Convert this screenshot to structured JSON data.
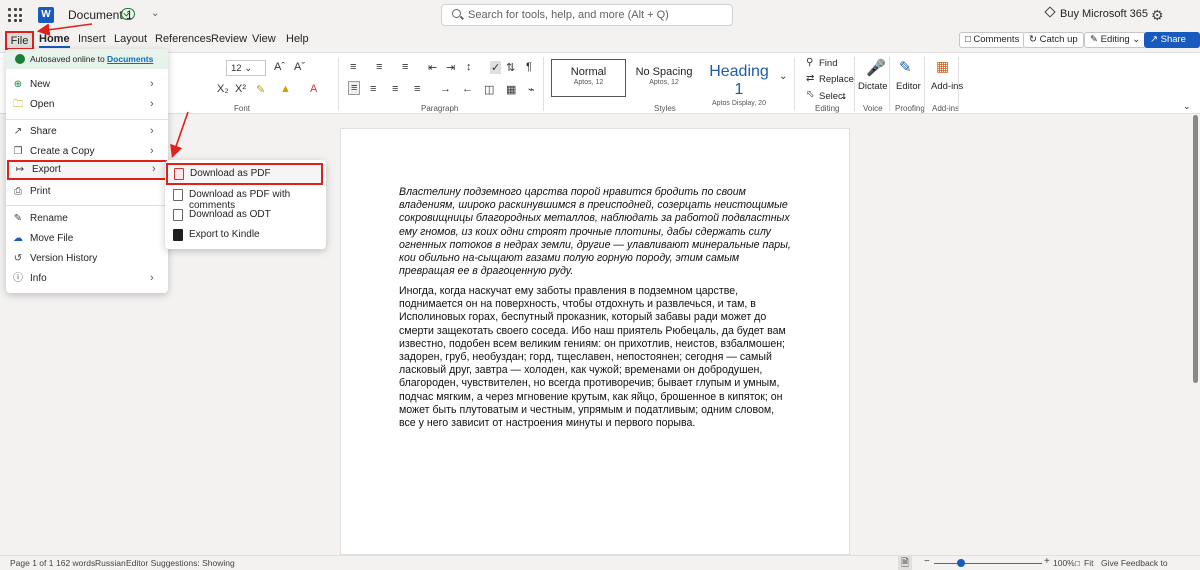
{
  "titlebar": {
    "app_icon": "word-logo-icon",
    "app_letter": "W",
    "doc_title": "Document 1",
    "search_placeholder": "Search for tools, help, and more (Alt + Q)",
    "buy_label": "Buy Microsoft 365"
  },
  "tabs": {
    "file": "File",
    "home": "Home",
    "insert": "Insert",
    "layout": "Layout",
    "references": "References",
    "review": "Review",
    "view": "View",
    "help": "Help"
  },
  "actions": {
    "comments": "Comments",
    "catch_up": "Catch up",
    "editing": "Editing",
    "share": "Share"
  },
  "ribbon": {
    "font_size": "12",
    "font_group": "Font",
    "paragraph_group": "Paragraph",
    "styles_group": "Styles",
    "editing_group": "Editing",
    "voice_group": "Voice",
    "proofing_group": "Proofing",
    "addins_group": "Add-ins",
    "styles": [
      {
        "name": "Normal",
        "sub": "Aptos, 12"
      },
      {
        "name": "No Spacing",
        "sub": "Aptos, 12"
      },
      {
        "name": "Heading 1",
        "sub": "Aptos Display, 20"
      }
    ],
    "find": "Find",
    "replace": "Replace",
    "select": "Select",
    "dictate": "Dictate",
    "editor": "Editor",
    "addins": "Add-ins",
    "accent_color": "#185abd",
    "highlight_color": "#e0201b"
  },
  "file_menu": {
    "autosaved_prefix": "Autosaved online to",
    "autosaved_link": "Documents",
    "items": [
      {
        "label": "New",
        "icon": "new-doc-icon"
      },
      {
        "label": "Open",
        "icon": "folder-open-icon"
      },
      {
        "label": "Share",
        "icon": "share-icon"
      },
      {
        "label": "Create a Copy",
        "icon": "copy-icon"
      },
      {
        "label": "Export",
        "icon": "export-icon"
      },
      {
        "label": "Print",
        "icon": "print-icon"
      },
      {
        "label": "Rename",
        "icon": "rename-icon"
      },
      {
        "label": "Move File",
        "icon": "move-file-icon"
      },
      {
        "label": "Version History",
        "icon": "history-icon"
      },
      {
        "label": "Info",
        "icon": "info-icon"
      }
    ]
  },
  "export_submenu": {
    "items": [
      {
        "label": "Download as PDF",
        "icon": "pdf-icon"
      },
      {
        "label": "Download as PDF with comments",
        "icon": "pdf-comments-icon"
      },
      {
        "label": "Download as ODT",
        "icon": "odt-icon"
      },
      {
        "label": "Export to Kindle",
        "icon": "kindle-icon"
      }
    ]
  },
  "document": {
    "para1": "Властелину подземного царства порой нравится бродить по своим владениям, широко раскинувшимся в преисподней, созерцать неистощимые сокровищницы благородных металлов, наблюдать за работой подвластных ему гномов, из коих одни строят прочные плотины, дабы сдержать силу огненных потоков в недрах земли, другие — улавливают минеральные пары, кои обильно на-сыщают газами полую горную породу, этим самым превращая ее в драгоценную руду.",
    "para2": "Иногда, когда наскучат ему заботы правления в подземном царстве, поднимается он на поверхность, чтобы отдохнуть и развлечься, и там, в Исполиновых горах, беспутный проказник, который забавы ради может до смерти защекотать своего соседа. Ибо наш приятель Рюбецаль, да будет вам известно, подобен всем великим гениям: он прихотлив, неистов, взбалмошен; задорен, груб, необуздан; горд, тщеславен, непостоянен; сегодня — самый ласковый друг, завтра — холоден, как чужой; временами он добродушен, благороден, чувствителен, но всегда противоречив; бывает глупым и умным, подчас мягким, а через мгновение крутым, как яйцо, брошенное в кипяток; он может быть плутоватым и честным, упрямым и податливым; одним словом, все у него зависит от настроения минуты и первого порыва."
  },
  "status": {
    "page": "Page 1 of 1",
    "words": "162 words",
    "language": "Russian",
    "editor_suggestions": "Editor Suggestions: Showing",
    "zoom": "100%",
    "fit": "Fit",
    "feedback": "Give Feedback to Microsoft"
  }
}
